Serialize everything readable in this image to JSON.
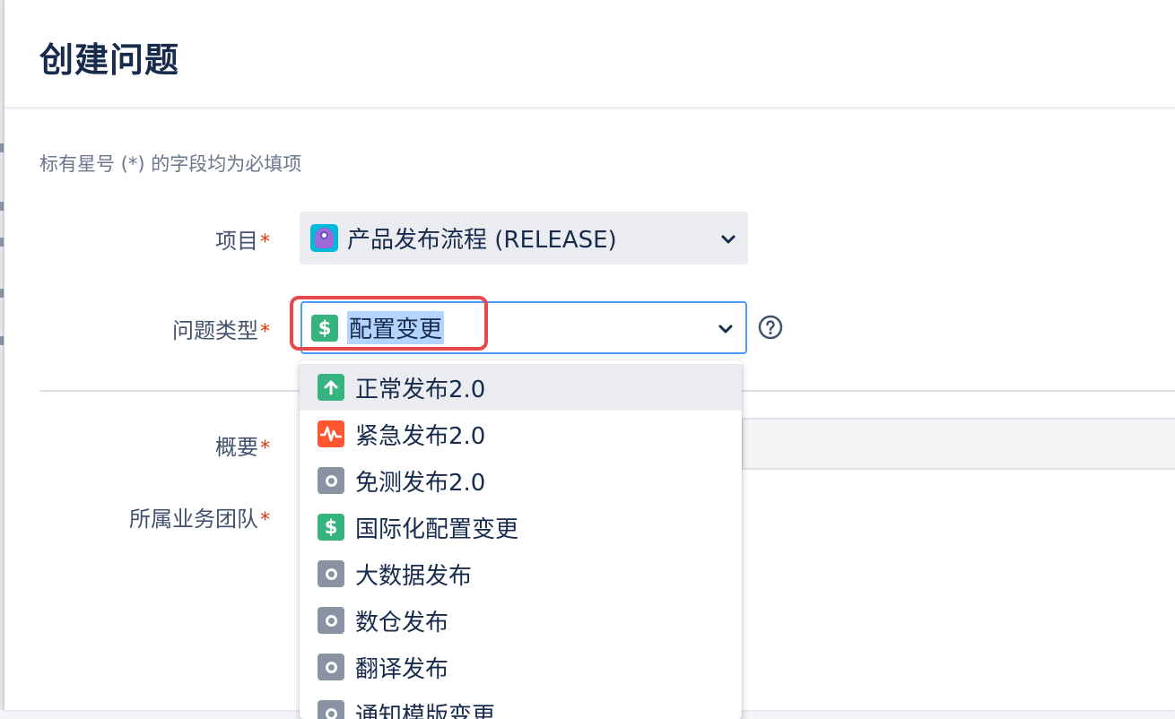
{
  "dialog": {
    "title": "创建问题",
    "required_note": "标有星号 (*) 的字段均为必填项"
  },
  "fields": {
    "project": {
      "label": "项目",
      "required_mark": "*",
      "value": "产品发布流程 (RELEASE)",
      "icon": "project-avatar-icon"
    },
    "issue_type": {
      "label": "问题类型",
      "required_mark": "*",
      "value": "配置变更",
      "icon": "dollar-icon"
    },
    "summary": {
      "label": "概要",
      "required_mark": "*",
      "value": ""
    },
    "team": {
      "label": "所属业务团队",
      "required_mark": "*"
    }
  },
  "issue_type_options": [
    {
      "label": "正常发布2.0",
      "icon": "arrow-up-icon",
      "color": "#36b37e",
      "highlighted": true
    },
    {
      "label": "紧急发布2.0",
      "icon": "pulse-icon",
      "color": "#ff5630"
    },
    {
      "label": "免测发布2.0",
      "icon": "circle-icon",
      "color": "#8993a4"
    },
    {
      "label": "国际化配置变更",
      "icon": "dollar-icon",
      "color": "#36b37e"
    },
    {
      "label": "大数据发布",
      "icon": "circle-icon",
      "color": "#8993a4"
    },
    {
      "label": "数仓发布",
      "icon": "circle-icon",
      "color": "#8993a4"
    },
    {
      "label": "翻译发布",
      "icon": "circle-icon",
      "color": "#8993a4"
    },
    {
      "label": "通知模版变更",
      "icon": "circle-icon",
      "color": "#8993a4"
    }
  ],
  "colors": {
    "focus_border": "#4c9aff",
    "selection_highlight": "#b3d4ff",
    "annotation_box": "#e5484d",
    "required_star": "#de350b"
  }
}
